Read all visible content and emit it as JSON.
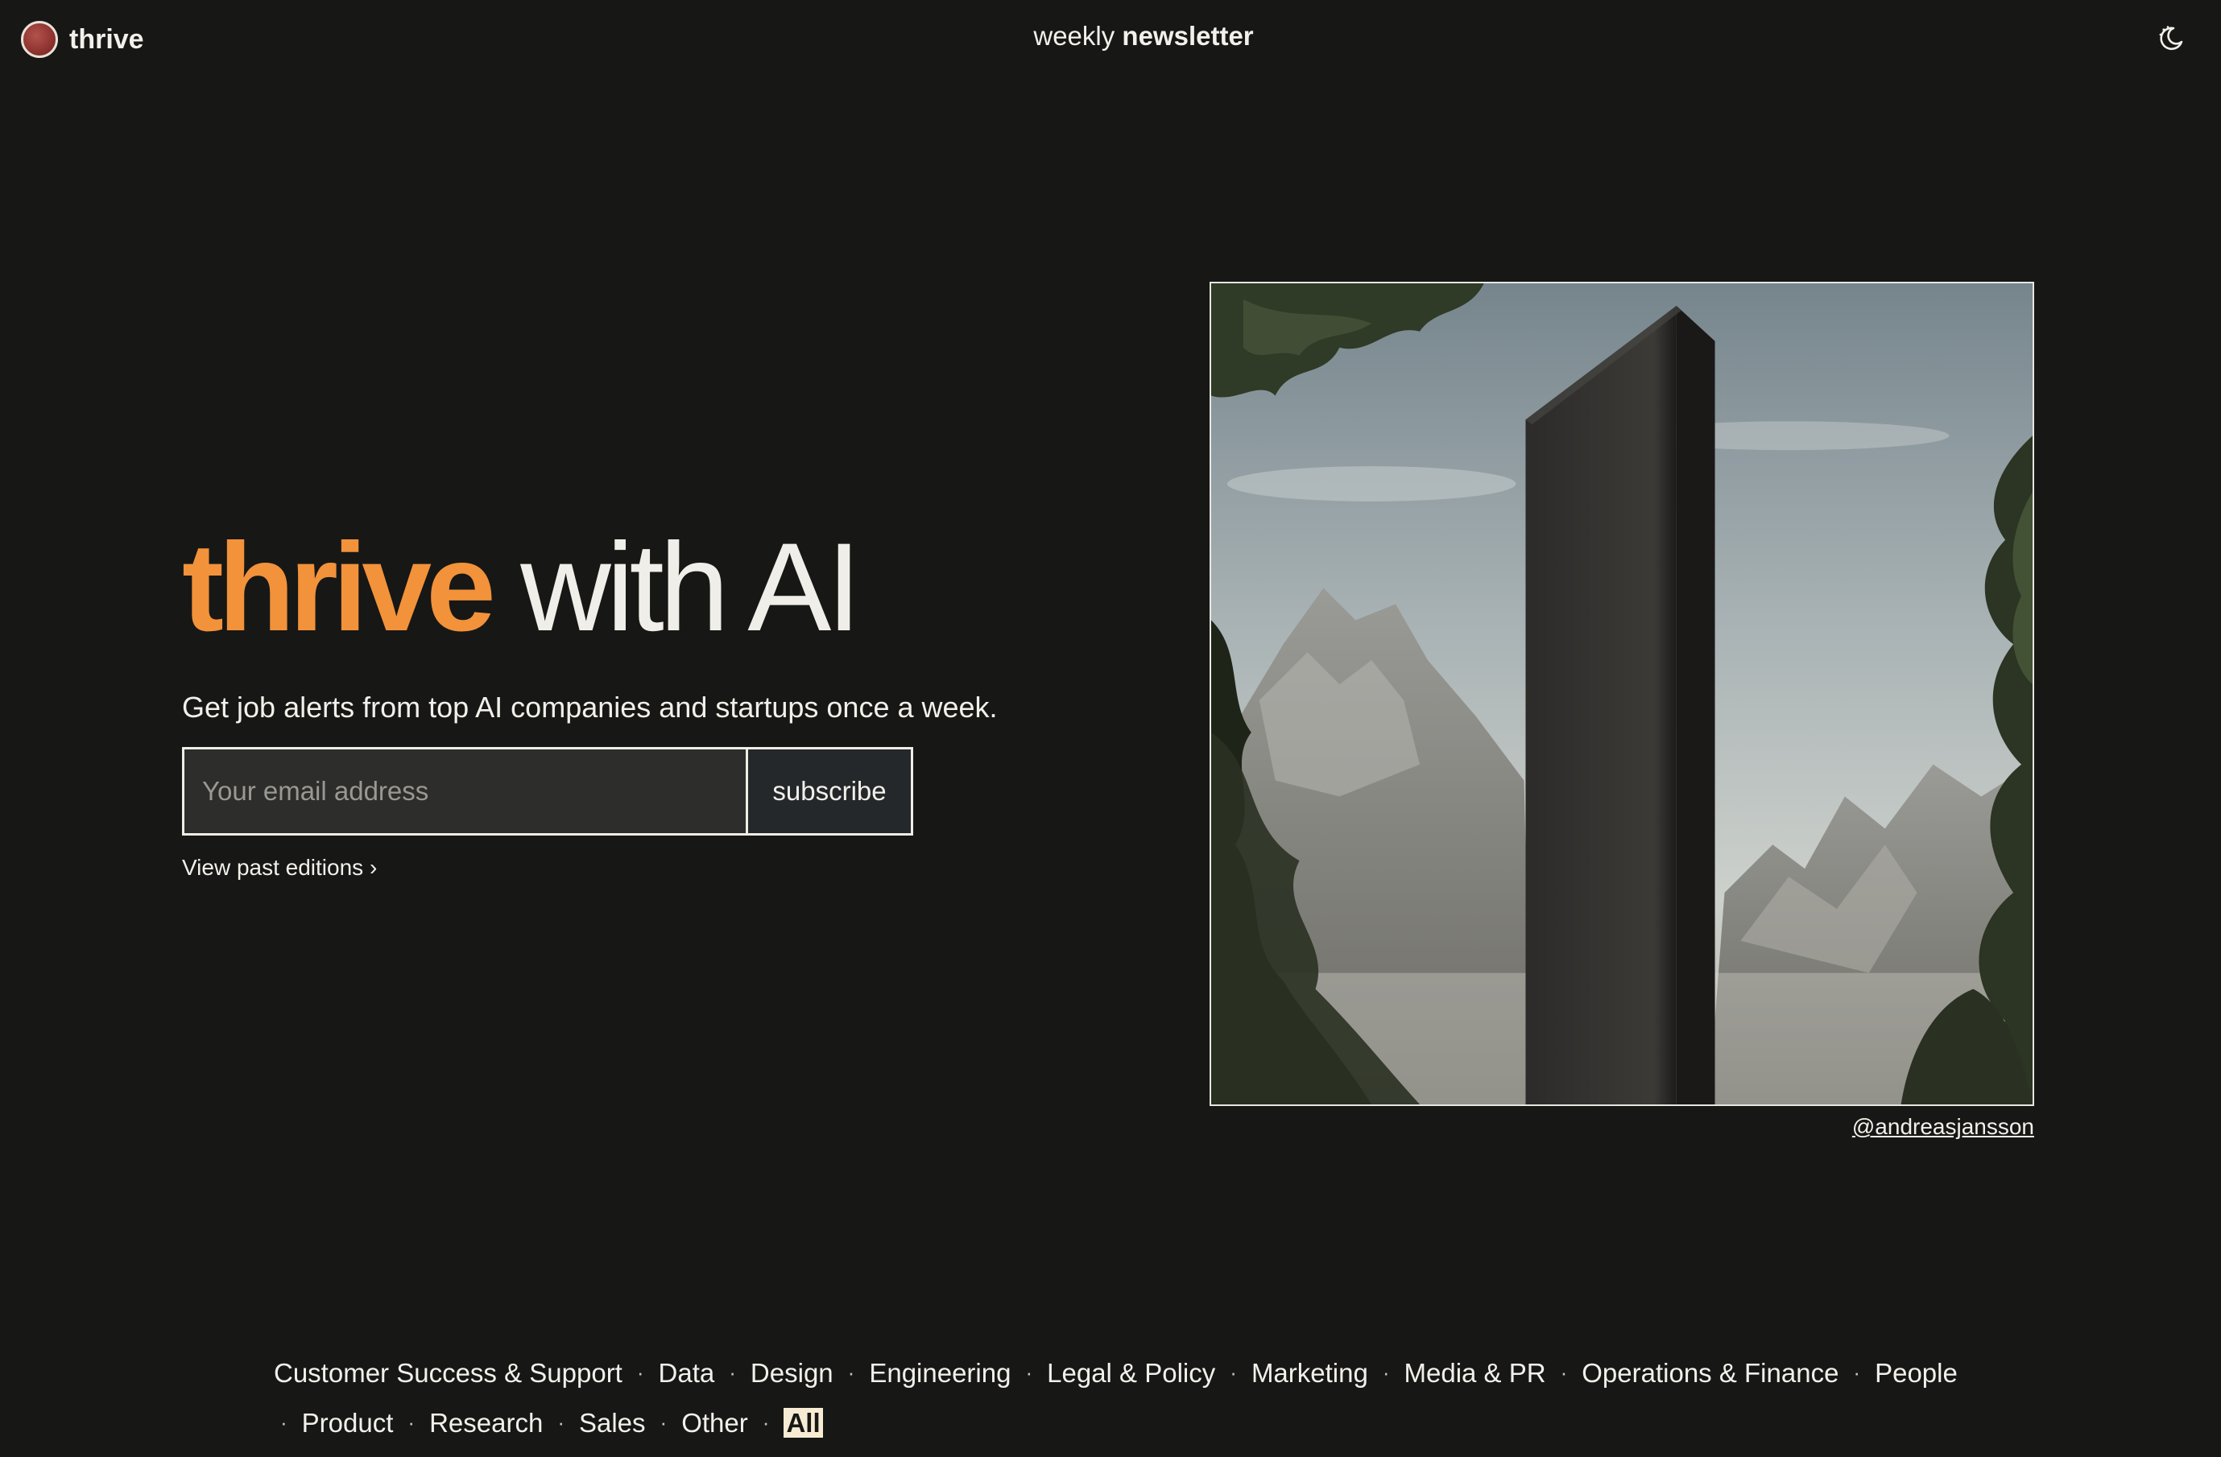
{
  "header": {
    "brand_name": "thrive",
    "nav_prefix": "weekly",
    "nav_bold": "newsletter",
    "theme_icon": "moon-icon"
  },
  "hero": {
    "title_accent": "thrive",
    "title_rest": "with AI",
    "subtitle": "Get job alerts from top AI companies and startups once a week.",
    "email_placeholder": "Your email address",
    "email_value": "",
    "subscribe_label": "subscribe",
    "past_editions_label": "View past editions ›"
  },
  "image": {
    "credit": "@andreasjansson"
  },
  "categories": {
    "row1": [
      "Customer Success & Support",
      "Data",
      "Design",
      "Engineering",
      "Legal & Policy",
      "Marketing",
      "Media & PR",
      "Operations & Finance",
      "People"
    ],
    "row2": [
      "Product",
      "Research",
      "Sales",
      "Other",
      "All"
    ],
    "selected": "All",
    "separator": "·"
  },
  "colors": {
    "background": "#171716",
    "accent": "#f2923a",
    "selected_highlight": "#f7ecd3",
    "brand_dot": "#8e3330"
  }
}
